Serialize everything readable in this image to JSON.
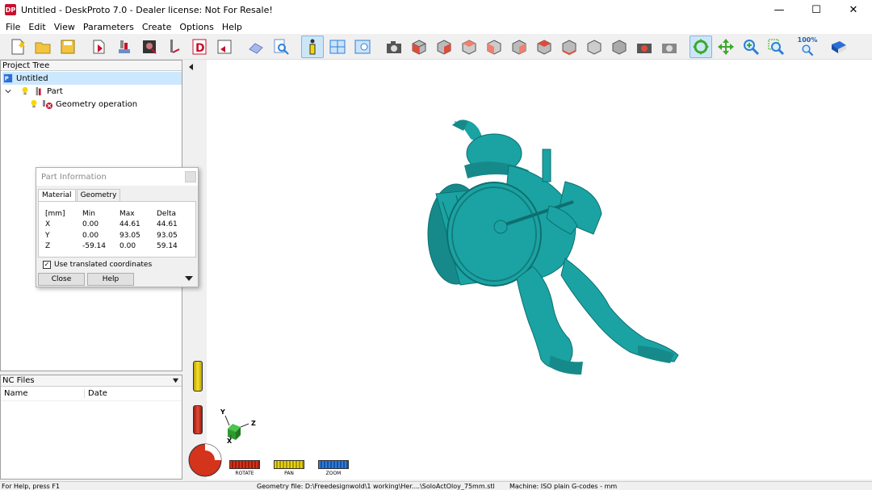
{
  "window": {
    "title": "Untitled - DeskProto 7.0 - Dealer license: Not For Resale!",
    "app_icon": "DP",
    "minimize": "—",
    "maximize": "☐",
    "close": "✕"
  },
  "menu": [
    "File",
    "Edit",
    "View",
    "Parameters",
    "Create",
    "Options",
    "Help"
  ],
  "toolbar": {
    "zoom_label": "100%"
  },
  "project_tree": {
    "header": "Project Tree",
    "items": [
      {
        "label": "Untitled",
        "level": 0
      },
      {
        "label": "Part",
        "level": 1
      },
      {
        "label": "Geometry operation",
        "level": 2
      }
    ]
  },
  "part_info": {
    "title": "Part Information",
    "tabs": [
      "Material",
      "Geometry"
    ],
    "table_header": [
      "[mm]",
      "Min",
      "Max",
      "Delta"
    ],
    "rows": [
      [
        "X",
        "0.00",
        "44.61",
        "44.61"
      ],
      [
        "Y",
        "0.00",
        "93.05",
        "93.05"
      ],
      [
        "Z",
        "-59.14",
        "0.00",
        "59.14"
      ]
    ],
    "checkbox_label": "Use translated coordinates",
    "close_label": "Close",
    "help_label": "Help"
  },
  "nc_files": {
    "header": "NC Files",
    "columns": [
      "Name",
      "Date"
    ]
  },
  "view_modes": {
    "rotate": "ROTATE",
    "pan": "PAN",
    "zoom": "ZOOM"
  },
  "axes": {
    "x": "X",
    "y": "Y",
    "z": "Z"
  },
  "status": {
    "help": "For Help, press F1",
    "geometry": "Geometry file: D:\\Freedesignwold\\1 working\\Her....\\SoloActOloy_75mm.stl",
    "machine": "Machine: ISO plain G-codes - mm"
  },
  "colors": {
    "model": "#1ba3a3",
    "model_shadow": "#0e6f70",
    "rotate": "#d4331c",
    "pan": "#e8d310",
    "zoom": "#2b7fd6"
  }
}
